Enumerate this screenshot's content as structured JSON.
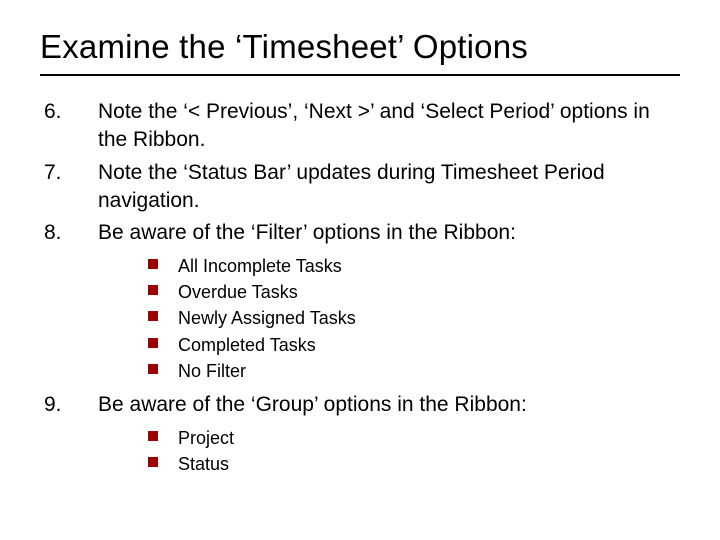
{
  "title": "Examine the ‘Timesheet’ Options",
  "items": [
    {
      "num": "6.",
      "text": "Note the ‘< Previous’, ‘Next >’ and ‘Select Period’ options in the Ribbon."
    },
    {
      "num": "7.",
      "text": "Note the ‘Status Bar’ updates during Timesheet Period navigation."
    },
    {
      "num": "8.",
      "text": "Be aware of the ‘Filter’ options in the Ribbon:"
    }
  ],
  "filterOptions": [
    "All Incomplete Tasks",
    "Overdue Tasks",
    "Newly Assigned Tasks",
    "Completed Tasks",
    "No Filter"
  ],
  "item9": {
    "num": "9.",
    "text": "Be aware of the ‘Group’ options in the Ribbon:"
  },
  "groupOptions": [
    "Project",
    "Status"
  ],
  "colors": {
    "bullet": "#9a0000"
  }
}
